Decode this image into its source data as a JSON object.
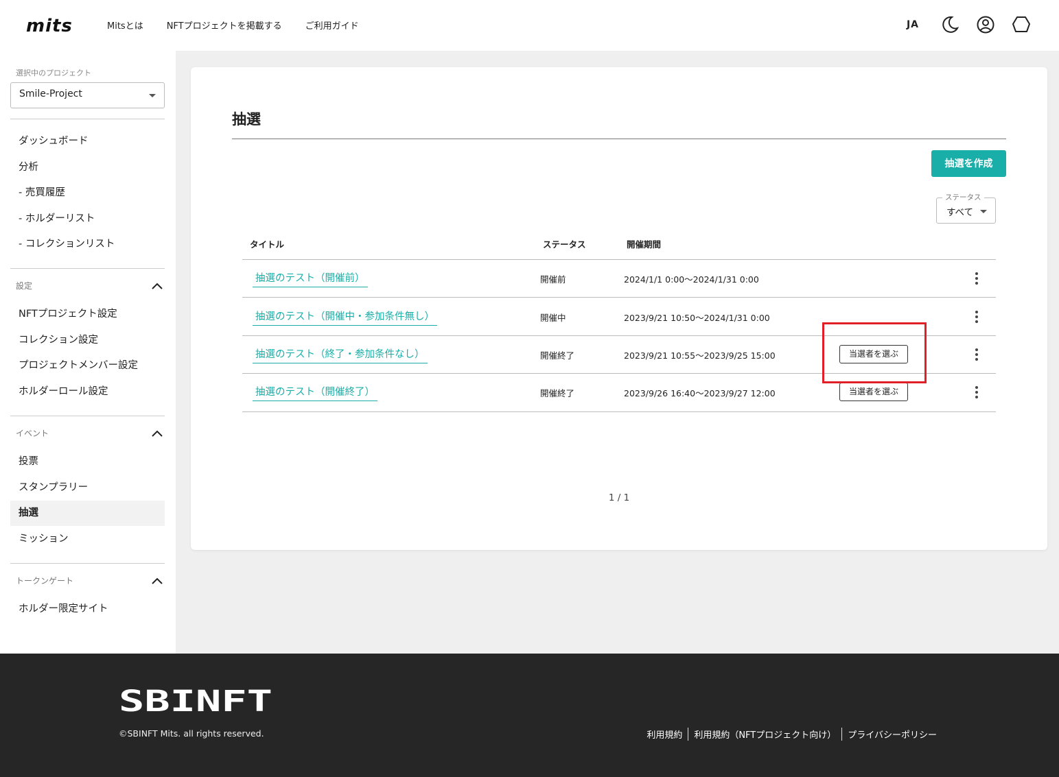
{
  "header": {
    "logo_text": "mits",
    "nav": [
      "Mitsとは",
      "NFTプロジェクトを掲載する",
      "ご利用ガイド"
    ],
    "language": "JA"
  },
  "sidebar": {
    "project_caption": "選択中のプロジェクト",
    "project_value": "Smile-Project",
    "top_items": [
      "ダッシュボード",
      "分析",
      "- 売買履歴",
      "- ホルダーリスト",
      "- コレクションリスト"
    ],
    "settings_label": "設定",
    "settings_items": [
      "NFTプロジェクト設定",
      "コレクション設定",
      "プロジェクトメンバー設定",
      "ホルダーロール設定"
    ],
    "events_label": "イベント",
    "events_items": [
      "投票",
      "スタンプラリー",
      "抽選",
      "ミッション"
    ],
    "token_gate_label": "トークンゲート",
    "token_gate_items": [
      "ホルダー限定サイト"
    ]
  },
  "main": {
    "title": "抽選",
    "create_button": "抽選を作成",
    "status_filter_label": "ステータス",
    "status_filter_value": "すべて",
    "columns": [
      "タイトル",
      "ステータス",
      "開催期間"
    ],
    "rows": [
      {
        "title": "抽選のテスト（開催前）",
        "status": "開催前",
        "period": "2024/1/1 0:00〜2024/1/31 0:00",
        "action": ""
      },
      {
        "title": "抽選のテスト（開催中・参加条件無し）",
        "status": "開催中",
        "period": "2023/9/21 10:50〜2024/1/31 0:00",
        "action": ""
      },
      {
        "title": "抽選のテスト（終了・参加条件なし）",
        "status": "開催終了",
        "period": "2023/9/21 10:55〜2023/9/25 15:00",
        "action": "当選者を選ぶ"
      },
      {
        "title": "抽選のテスト（開催終了）",
        "status": "開催終了",
        "period": "2023/9/26 16:40〜2023/9/27 12:00",
        "action": "当選者を選ぶ"
      }
    ],
    "pagination": "1 / 1"
  },
  "footer": {
    "brand": "SBINFT",
    "copyright": "©SBINFT Mits. all rights reserved.",
    "links": [
      "利用規約",
      "利用規約（NFTプロジェクト向け）",
      "プライバシーポリシー"
    ]
  },
  "colors": {
    "accent": "#1aaea9",
    "highlight": "#e01f26",
    "footer_bg": "#262626"
  }
}
